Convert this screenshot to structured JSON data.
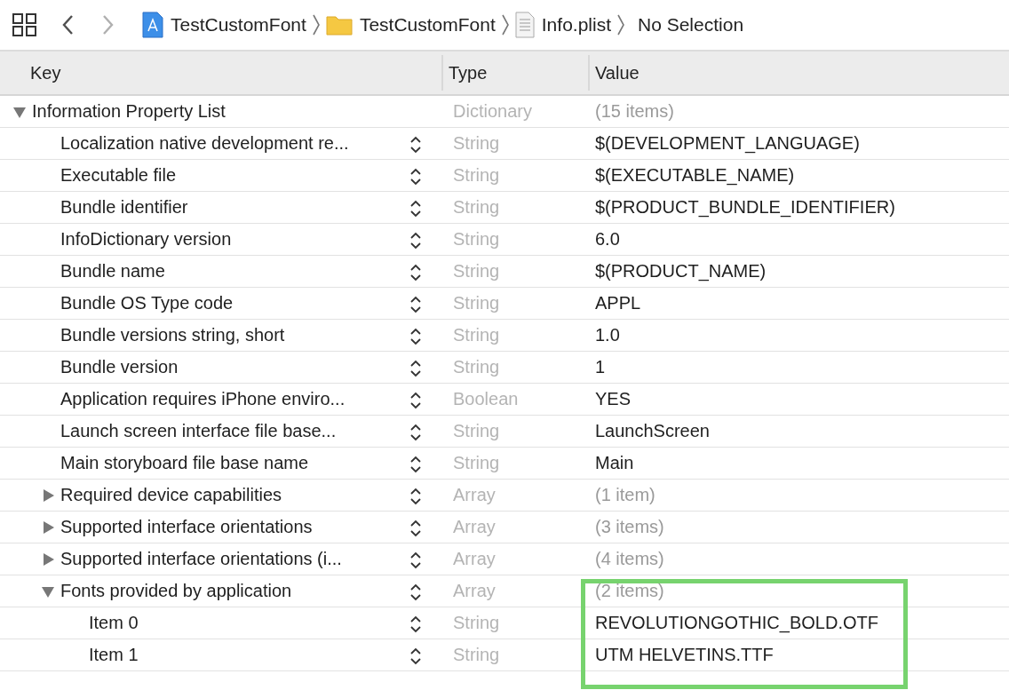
{
  "breadcrumb": [
    {
      "kind": "project",
      "label": "TestCustomFont"
    },
    {
      "kind": "folder",
      "label": "TestCustomFont"
    },
    {
      "kind": "plist",
      "label": "Info.plist"
    },
    {
      "kind": "plain",
      "label": "No Selection"
    }
  ],
  "nav": {
    "back_disabled": false,
    "forward_disabled": true
  },
  "columns": [
    "Key",
    "Type",
    "Value"
  ],
  "rows": [
    {
      "key": "Information Property List",
      "type": "Dictionary",
      "value": "(15 items)",
      "expanded": true,
      "children": [
        {
          "key": "Localization native development re...",
          "type": "String",
          "value": "$(DEVELOPMENT_LANGUAGE)"
        },
        {
          "key": "Executable file",
          "type": "String",
          "value": "$(EXECUTABLE_NAME)"
        },
        {
          "key": "Bundle identifier",
          "type": "String",
          "value": "$(PRODUCT_BUNDLE_IDENTIFIER)"
        },
        {
          "key": "InfoDictionary version",
          "type": "String",
          "value": "6.0"
        },
        {
          "key": "Bundle name",
          "type": "String",
          "value": "$(PRODUCT_NAME)"
        },
        {
          "key": "Bundle OS Type code",
          "type": "String",
          "value": "APPL"
        },
        {
          "key": "Bundle versions string, short",
          "type": "String",
          "value": "1.0"
        },
        {
          "key": "Bundle version",
          "type": "String",
          "value": "1"
        },
        {
          "key": "Application requires iPhone enviro...",
          "type": "Boolean",
          "value": "YES"
        },
        {
          "key": "Launch screen interface file base...",
          "type": "String",
          "value": "LaunchScreen"
        },
        {
          "key": "Main storyboard file base name",
          "type": "String",
          "value": "Main"
        },
        {
          "key": "Required device capabilities",
          "type": "Array",
          "value": "(1 item)",
          "expanded": false
        },
        {
          "key": "Supported interface orientations",
          "type": "Array",
          "value": "(3 items)",
          "expanded": false
        },
        {
          "key": "Supported interface orientations (i...",
          "type": "Array",
          "value": "(4 items)",
          "expanded": false
        },
        {
          "key": "Fonts provided by application",
          "type": "Array",
          "value": "(2 items)",
          "expanded": true,
          "children": [
            {
              "key": "Item 0",
              "type": "String",
              "value": "REVOLUTIONGOTHIC_BOLD.OTF"
            },
            {
              "key": "Item 1",
              "type": "String",
              "value": "UTM HELVETINS.TTF"
            }
          ]
        }
      ]
    }
  ]
}
